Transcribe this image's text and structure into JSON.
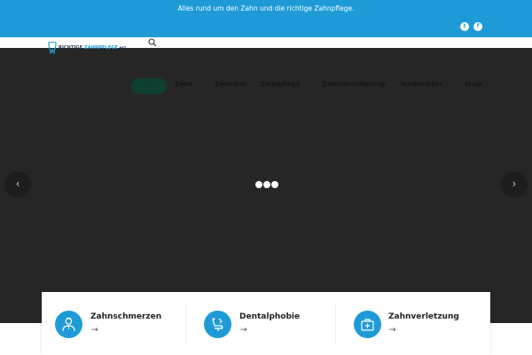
{
  "topbar": {
    "tagline": "Alles rund um den Zahn und die richtige Zahnpflege.",
    "social": [
      {
        "icon": "twitter-icon",
        "glyph": "t"
      },
      {
        "icon": "facebook-icon",
        "glyph": "f"
      }
    ]
  },
  "header": {
    "logo": {
      "part1": "RICHTIGE",
      "part2": "ZAHNPFLEGE",
      "suffix": ".NET"
    },
    "search_icon": "search-icon"
  },
  "nav": {
    "items": [
      {
        "label": "Home",
        "active": true,
        "has_submenu": false
      },
      {
        "label": "Zahn",
        "active": false,
        "has_submenu": true
      },
      {
        "label": "Zahnarzt",
        "active": false,
        "has_submenu": false
      },
      {
        "label": "Zahnpflege",
        "active": false,
        "has_submenu": true
      },
      {
        "label": "Zahnversicherung",
        "active": false,
        "has_submenu": false
      },
      {
        "label": "Testberichte",
        "active": false,
        "has_submenu": true
      },
      {
        "label": "Shop",
        "active": false,
        "has_submenu": false
      }
    ],
    "submenu_glyph": "⌄"
  },
  "slider": {
    "prev_glyph": "‹",
    "next_glyph": "›",
    "dot_count": 3
  },
  "cards": [
    {
      "title": "Zahnschmerzen",
      "arrow": "→",
      "icon": "doctor-icon"
    },
    {
      "title": "Dentalphobie",
      "arrow": "→",
      "icon": "dental-chair-icon"
    },
    {
      "title": "Zahnverletzung",
      "arrow": "→",
      "icon": "first-aid-kit-icon"
    }
  ],
  "colors": {
    "brand_blue": "#1e9bd7",
    "hero_bg": "#262626",
    "active_nav_bg": "#0f3f32",
    "nav_text": "#151515"
  }
}
